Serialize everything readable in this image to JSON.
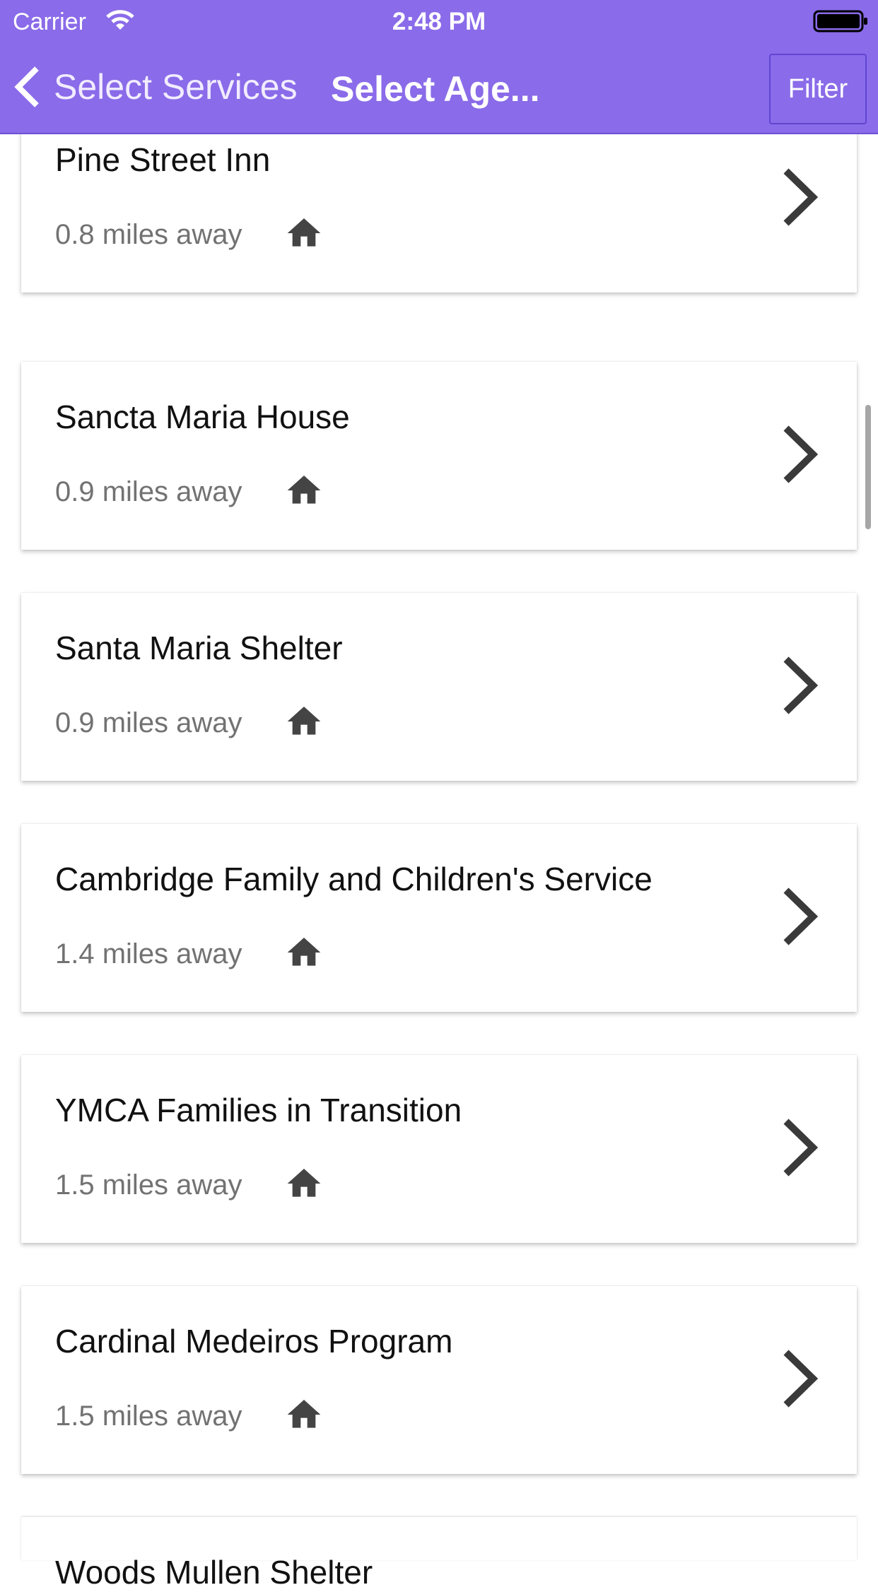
{
  "status_bar": {
    "carrier": "Carrier",
    "time": "2:48 PM",
    "wifi_icon": "wifi-icon",
    "battery_icon": "battery-icon"
  },
  "nav": {
    "back_label": "Select Services",
    "back_icon": "chevron-left-icon",
    "title": "Select Age...",
    "filter_label": "Filter",
    "background_color": "#8a6be9"
  },
  "results": [
    {
      "name": "Pine Street Inn",
      "distance": "0.8 miles away",
      "icon": "home-icon"
    },
    {
      "name": "Sancta Maria House",
      "distance": "0.9 miles away",
      "icon": "home-icon"
    },
    {
      "name": "Santa Maria Shelter",
      "distance": "0.9 miles away",
      "icon": "home-icon"
    },
    {
      "name": "Cambridge Family and Children's Service",
      "distance": "1.4 miles away",
      "icon": "home-icon"
    },
    {
      "name": "YMCA Families in Transition",
      "distance": "1.5 miles away",
      "icon": "home-icon"
    },
    {
      "name": "Cardinal Medeiros Program",
      "distance": "1.5 miles away",
      "icon": "home-icon"
    },
    {
      "name": "Woods Mullen Shelter",
      "distance": "",
      "icon": "home-icon"
    }
  ]
}
